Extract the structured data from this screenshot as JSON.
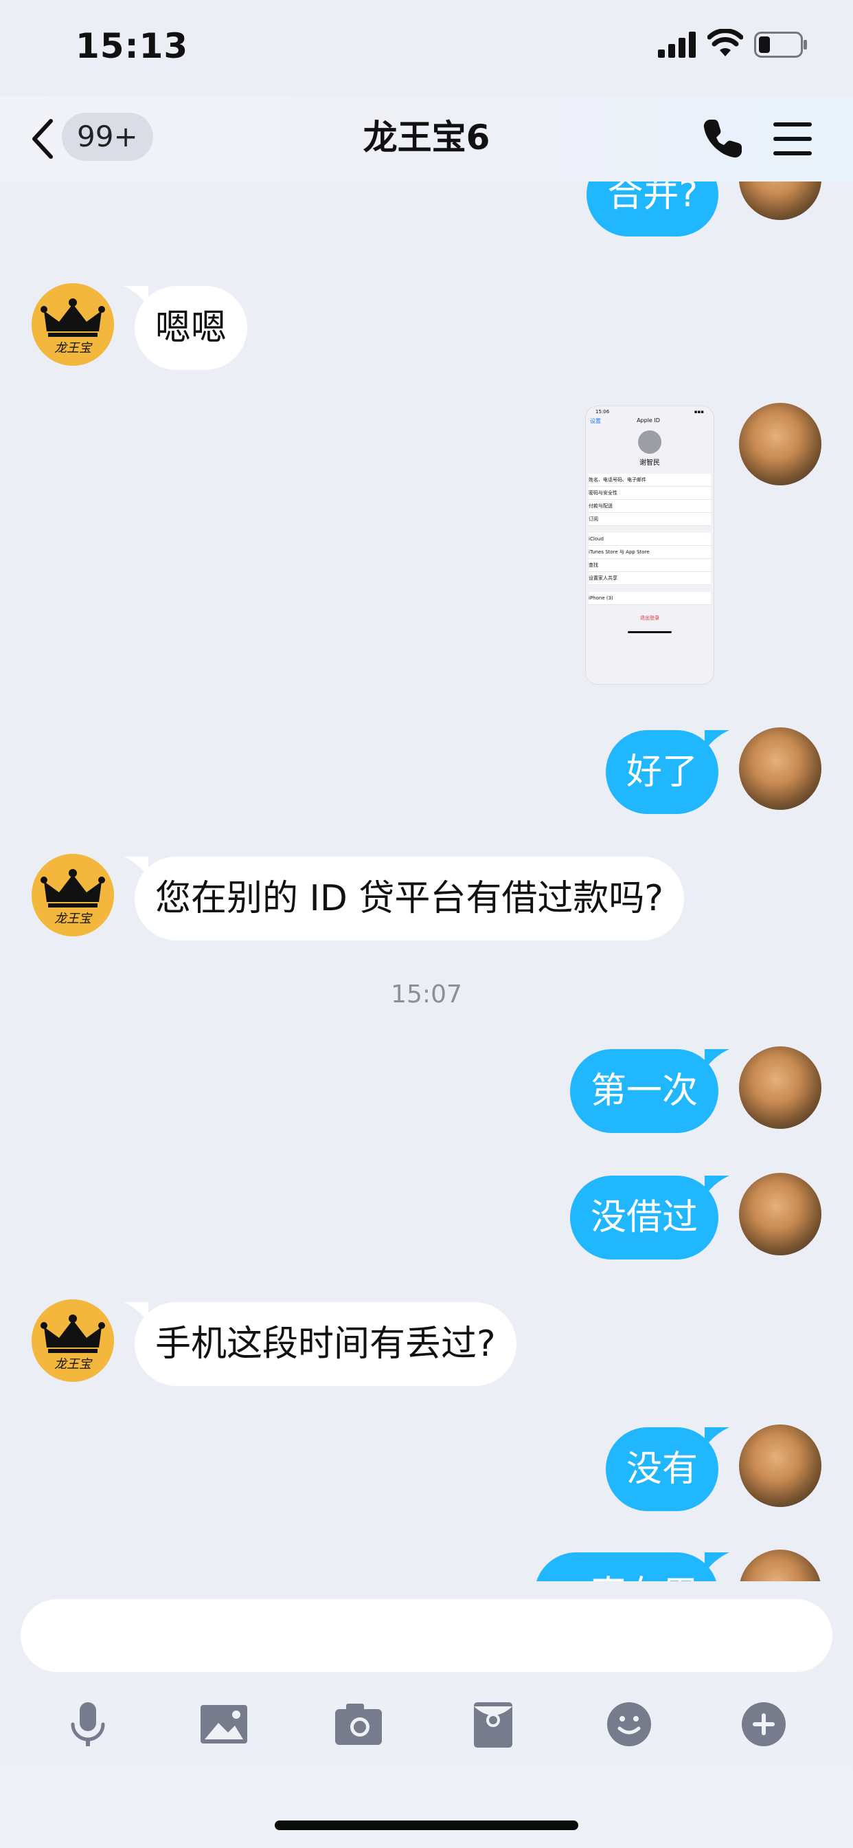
{
  "status_bar": {
    "time": "15:13"
  },
  "nav": {
    "badge": "99+",
    "title": "龙王宝6"
  },
  "messages": [
    {
      "side": "out",
      "text": "合并?"
    },
    {
      "side": "in",
      "text": "嗯嗯"
    },
    {
      "side": "out",
      "type": "image",
      "screenshot": {
        "time": "15:06",
        "back": "设置",
        "title": "Apple ID",
        "name": "谢智民",
        "rows": [
          "姓名、电话号码、电子邮件",
          "密码与安全性",
          "付款与配送",
          "订阅",
          "iCloud",
          "iTunes Store 与 App Store",
          "查找",
          "设置家人共享",
          "iPhone (3)"
        ],
        "signout": "退出登录"
      }
    },
    {
      "side": "out",
      "text": "好了"
    },
    {
      "side": "in",
      "text": "您在别的 ID 贷平台有借过款吗?"
    },
    {
      "side": "out",
      "text": "第一次"
    },
    {
      "side": "out",
      "text": "没借过"
    },
    {
      "side": "in",
      "text": "手机这段时间有丢过?"
    },
    {
      "side": "out",
      "text": "没有"
    },
    {
      "side": "out",
      "text": "一直在用"
    }
  ],
  "timestamp": "15:07",
  "avatar_other_text": "龙王宝",
  "input": {
    "placeholder": ""
  },
  "toolbar": [
    "microphone-icon",
    "image-icon",
    "camera-icon",
    "red-packet-icon",
    "emoji-icon",
    "plus-icon"
  ],
  "colors": {
    "bubble_out": "#21b7ff",
    "bubble_in": "#ffffff",
    "background": "#eceef5"
  }
}
